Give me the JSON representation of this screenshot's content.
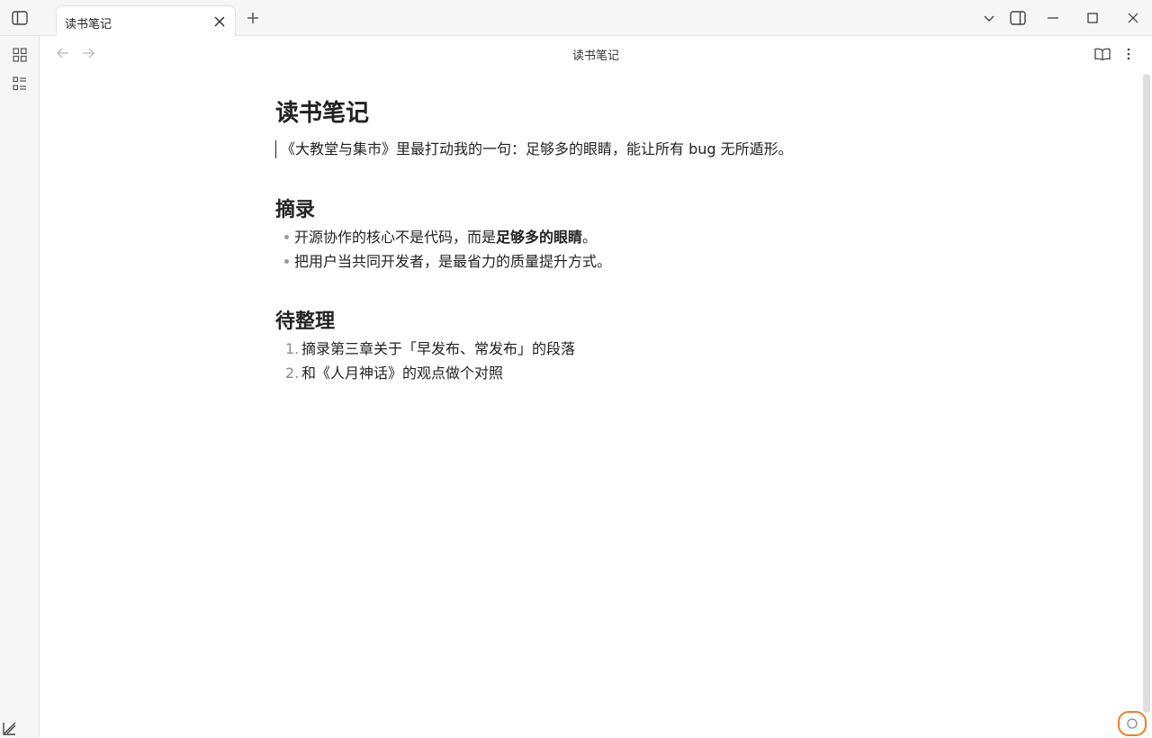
{
  "window": {
    "tab_label": "读书笔记"
  },
  "header": {
    "title": "读书笔记"
  },
  "note": {
    "title": "读书笔记",
    "intro": "《大教堂与集市》里最打动我的一句：足够多的眼睛，能让所有 bug 无所遁形。",
    "excerpts_heading": "摘录",
    "excerpts": [
      {
        "before": "开源协作的核心不是代码，而是",
        "bold": "足够多的眼睛",
        "after": "。"
      },
      {
        "before": "把用户当共同开发者，是最省力的质量提升方式。",
        "bold": "",
        "after": ""
      }
    ],
    "todo_heading": "待整理",
    "todos": [
      {
        "num": "1.",
        "text": "摘录第三章关于「早发布、常发布」的段落"
      },
      {
        "num": "2.",
        "text": "和《人月神话》的观点做个对照"
      }
    ]
  },
  "colors": {
    "accent_status": "#f07f1f"
  },
  "icons": {
    "sidebar_toggle": "sidebar-toggle-icon",
    "new_tab": "plus-icon",
    "tab_list": "chevron-down-icon",
    "right_sidebar": "right-sidebar-icon",
    "minimize": "minimize-icon",
    "maximize": "maximize-icon",
    "close": "close-icon",
    "grid": "grid-icon",
    "list": "list-icon",
    "back": "arrow-left-icon",
    "forward": "arrow-right-icon",
    "reading": "book-open-icon",
    "more": "more-options-icon",
    "help": "help-icon",
    "sync": "sync-status-icon"
  }
}
